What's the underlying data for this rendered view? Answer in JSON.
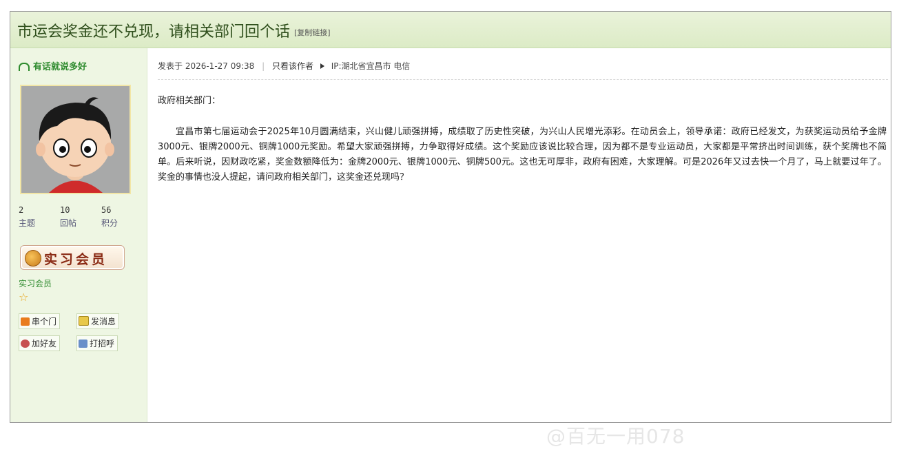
{
  "post": {
    "title": "市运会奖金还不兑现，请相关部门回个话",
    "copy_link": "[复制链接]",
    "meta_posted": "发表于 2026-1-27 09:38",
    "meta_only_author": "只看该作者",
    "meta_ip": "IP:湖北省宜昌市 电信",
    "greeting": "政府相关部门：",
    "body": "宜昌市第七届运动会于2025年10月圆满结束，兴山健儿顽强拼搏，成绩取了历史性突破，为兴山人民增光添彩。在动员会上，领导承诺：政府已经发文，为获奖运动员给予金牌3000元、银牌2000元、铜牌1000元奖励。希望大家顽强拼搏，力争取得好成绩。这个奖励应该说比较合理，因为都不是专业运动员，大家都是平常挤出时间训练，获个奖牌也不简单。后来听说，因财政吃紧，奖金数额降低为：金牌2000元、银牌1000元、铜牌500元。这也无可厚非，政府有困难，大家理解。可是2026年又过去快一个月了，马上就要过年了。奖金的事情也没人提起，请问政府相关部门，这奖金还兑现吗？"
  },
  "user": {
    "name": "有话就说多好",
    "topics_value": "2",
    "topics_label": "主题",
    "replies_value": "10",
    "replies_label": "回帖",
    "points_value": "56",
    "points_label": "积分",
    "badge_text": "实习会员",
    "rank": "实习会员",
    "star_icon": "☆"
  },
  "actions": {
    "visit": "串个门",
    "message": "发消息",
    "add_friend": "加好友",
    "greet": "打招呼"
  },
  "watermark": "@百无一用078",
  "colors": {
    "title_bg": "#dcebc6",
    "sidebar_bg": "#eef6e3",
    "username": "#2e8b2e"
  }
}
